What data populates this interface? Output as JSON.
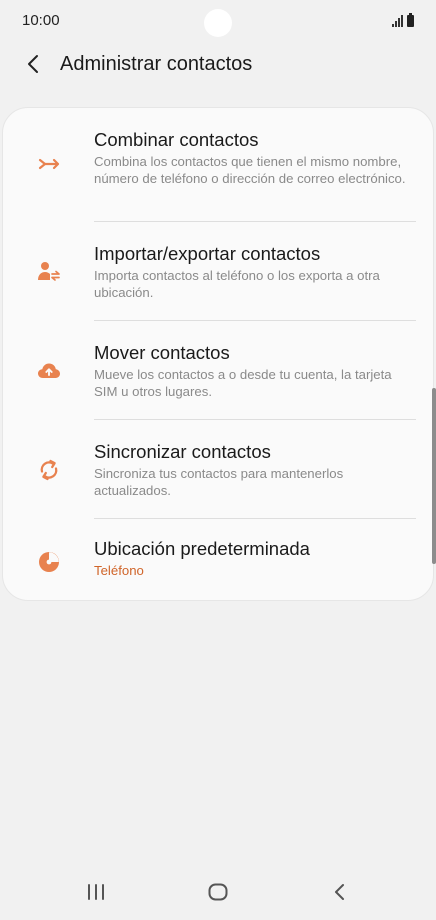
{
  "status": {
    "time": "10:00"
  },
  "header": {
    "title": "Administrar contactos"
  },
  "items": [
    {
      "title": "Combinar contactos",
      "subtitle": "Combina los contactos que tienen el mismo nombre, número de teléfono o dirección de correo electrónico.",
      "icon": "merge-icon"
    },
    {
      "title": "Importar/exportar contactos",
      "subtitle": "Importa contactos al teléfono o los exporta a otra ubicación.",
      "icon": "import-export-icon"
    },
    {
      "title": "Mover contactos",
      "subtitle": "Mueve los contactos a o desde tu cuenta, la tarjeta SIM u otros lugares.",
      "icon": "cloud-upload-icon"
    },
    {
      "title": "Sincronizar contactos",
      "subtitle": "Sincroniza tus contactos para mantenerlos actualizados.",
      "icon": "sync-icon"
    },
    {
      "title": "Ubicación predeterminada",
      "subtitle": "Teléfono",
      "icon": "default-location-icon"
    }
  ],
  "colors": {
    "accent": "#e8824f",
    "accent_text": "#d0652a",
    "background": "#f1f1f1",
    "card": "#fafafa"
  }
}
